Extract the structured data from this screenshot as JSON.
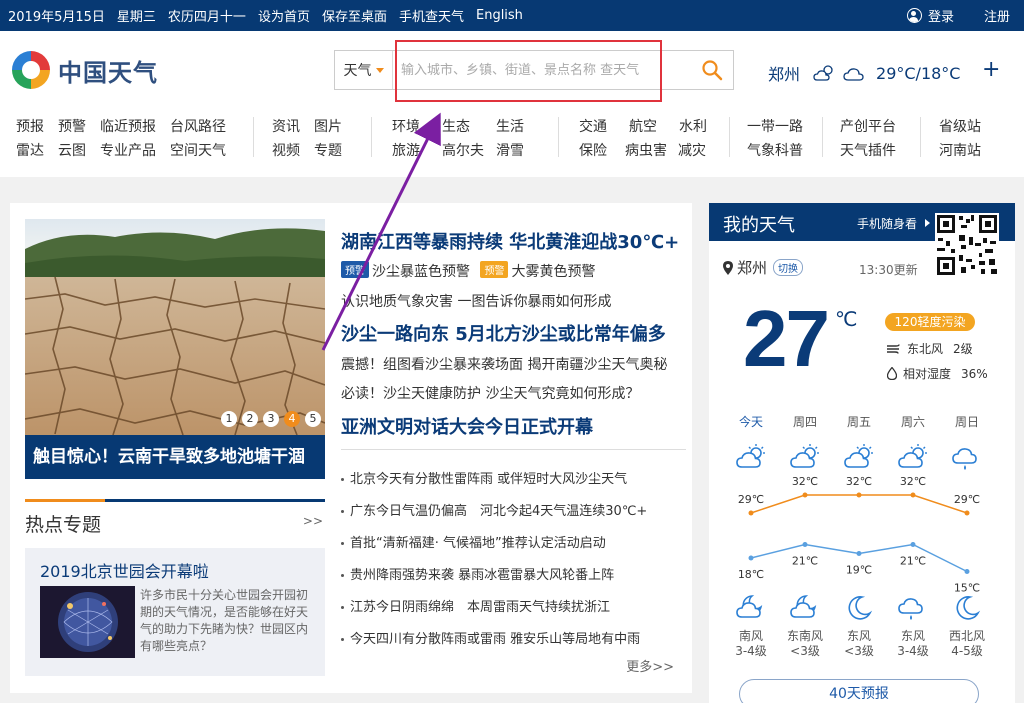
{
  "topbar": {
    "date": "2019年5月15日",
    "weekday": "星期三",
    "lunar": "农历四月十一",
    "set_home": "设为首页",
    "save_desktop": "保存至桌面",
    "mobile": "手机查天气",
    "english": "English",
    "login": "登录",
    "register": "注册"
  },
  "logo": {
    "text": "中国天气"
  },
  "search": {
    "type": "天气",
    "placeholder": "输入城市、乡镇、街道、景点名称 查天气"
  },
  "current": {
    "city": "郑州",
    "temps": "29°C/18°C",
    "plus": "+"
  },
  "nav": {
    "g1": {
      "r1": [
        "预报",
        "预警",
        "临近预报",
        "台风路径"
      ],
      "r2": [
        "雷达",
        "云图",
        "专业产品",
        "空间天气"
      ]
    },
    "g2": {
      "r1": [
        "资讯",
        "图片"
      ],
      "r2": [
        "视频",
        "专题"
      ]
    },
    "g3": {
      "r1": [
        "环境",
        "生态",
        "生活"
      ],
      "r2": [
        "旅游",
        "高尔夫",
        "滑雪"
      ]
    },
    "g4": {
      "r1": [
        "交通",
        "航空",
        "水利"
      ],
      "r2": [
        "保险",
        "病虫害",
        "减灾"
      ]
    },
    "g5": {
      "r1": [
        "一带一路"
      ],
      "r2": [
        "气象科普"
      ]
    },
    "g6": {
      "r1": [
        "产创平台"
      ],
      "r2": [
        "天气插件"
      ]
    },
    "g7": {
      "r1": [
        "省级站"
      ],
      "r2": [
        "河南站"
      ]
    }
  },
  "hero": {
    "caption": "触目惊心！云南干旱致多地池塘干涸",
    "dots": [
      "1",
      "2",
      "3",
      "4",
      "5"
    ],
    "active_dot": 4
  },
  "headlines": {
    "h1": "湖南江西等暴雨持续 华北黄淮迎战30℃+",
    "tag1": "预警",
    "alert1": "沙尘暴蓝色预警",
    "tag2": "预警",
    "alert2": "大雾黄色预警",
    "s1": "认识地质气象灾害 一图告诉你暴雨如何形成",
    "h2": "沙尘一路向东 5月北方沙尘或比常年偏多",
    "s2": "震撼！组图看沙尘暴来袭场面 揭开南疆沙尘天气奥秘",
    "s3": "必读！沙尘天健康防护 沙尘天气究竟如何形成？",
    "h3": "亚洲文明对话大会今日正式开幕"
  },
  "news": [
    "北京今天有分散性雷阵雨 或伴短时大风沙尘天气",
    "广东今日气温仍偏高　河北今起4天气温连续30℃+",
    "首批“清新福建· 气候福地”推荐认定活动启动",
    "贵州降雨强势来袭 暴雨冰雹雷暴大风轮番上阵",
    "江苏今日阴雨绵绵　本周雷雨天气持续扰浙江",
    "今天四川有分散阵雨或雷雨 雅安乐山等局地有中雨"
  ],
  "more": "更多>>",
  "topic": {
    "header": "热点专题",
    "arrows": ">>",
    "title": "2019北京世园会开幕啦",
    "desc": "许多市民十分关心世园会开园初期的天气情况，是否能够在好天气的助力下先睹为快？世园区内有哪些亮点？"
  },
  "my_weather": {
    "title": "我的天气",
    "mobile": "手机随身看",
    "city": "郑州",
    "switch": "切换",
    "update": "13:30更新",
    "temp": "27",
    "unit": "℃",
    "aqi": "120轻度污染",
    "wind_dir": "东北风",
    "wind_lv": "2级",
    "hum_label": "相对湿度",
    "hum_val": "36%",
    "btn40": "40天预报"
  },
  "forecast": {
    "days": [
      "今天",
      "周四",
      "周五",
      "周六",
      "周日"
    ],
    "day_icons": [
      "partly-cloudy-icon",
      "partly-cloudy-icon",
      "partly-cloudy-icon",
      "partly-cloudy-icon",
      "rain-icon"
    ],
    "highs": [
      29,
      32,
      32,
      32,
      29
    ],
    "lows": [
      18,
      21,
      19,
      21,
      15
    ],
    "night_icons": [
      "cloudy-night-icon",
      "cloudy-night-icon",
      "moon-icon",
      "rain-icon",
      "moon-icon"
    ],
    "winds": [
      [
        "南风",
        "3-4级"
      ],
      [
        "东南风",
        "<3级"
      ],
      [
        "东风",
        "<3级"
      ],
      [
        "东风",
        "3-4级"
      ],
      [
        "西北风",
        "4-5级"
      ]
    ],
    "high_color": "#f08c1c",
    "low_color": "#5aa0e0"
  },
  "colors": {
    "brand": "#073973",
    "accent": "#f08c1c",
    "highlight": "#e0333c",
    "arrow": "#7b1fa2"
  }
}
